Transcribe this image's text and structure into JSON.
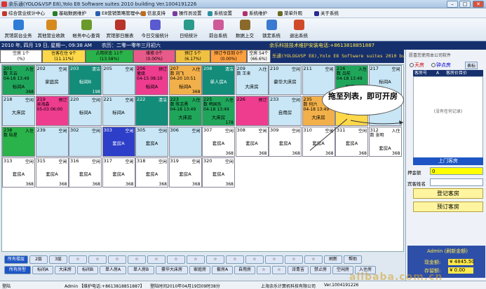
{
  "window": {
    "title": "余乐通(YOLO&VSP E8),Yolo E8 Software suites 2010 building Ver.1004191226"
  },
  "menu": [
    {
      "label": "综合营业统计中心",
      "color": "#c2392b"
    },
    {
      "label": "基础数据维护",
      "color": "#2b7d2b"
    },
    {
      "label": "E8营销策略管理中心",
      "color": "#2a5fb0"
    },
    {
      "label": "信息支持",
      "color": "#c06b1a"
    },
    {
      "label": "操作员设置",
      "color": "#7a3aa0"
    },
    {
      "label": "系统设置",
      "color": "#2a8fa0"
    },
    {
      "label": "系统维护",
      "color": "#b03070"
    },
    {
      "label": "菜单外观",
      "color": "#6a6a20"
    },
    {
      "label": "关于系统",
      "color": "#2a2a90"
    }
  ],
  "toolbar": [
    {
      "label": "宾馆前台业务",
      "color": "#2e7cd6"
    },
    {
      "label": "其他营业收款",
      "color": "#d68a1e"
    },
    {
      "label": "帐务中心查询",
      "color": "#6a9a2a"
    },
    {
      "label": "宾馆部日报表",
      "color": "#b8332a"
    },
    {
      "label": "今日交接统计",
      "color": "#5a5ad0"
    },
    {
      "label": "日结统计",
      "color": "#2a9a8a"
    },
    {
      "label": "前台系统",
      "color": "#cf5a9a"
    },
    {
      "label": "数据上交",
      "color": "#8a6a2a"
    },
    {
      "label": "锁定系统",
      "color": "#3a7ad0"
    },
    {
      "label": "退出系统",
      "color": "#d04a2a"
    }
  ],
  "statusline": {
    "date": "2010 年, 四月 19 日, 星期一, 09:38 AM",
    "lunar": "农历：二零一零年三月初六",
    "marquee": "余乐科技技术维护安装电话:+8613818851887"
  },
  "legend": [
    {
      "label": "空房 1个\n(%)",
      "bg": "#ffffff"
    },
    {
      "label": "住客在住 9个\n(11.11%)",
      "bg": "#ffd84a"
    },
    {
      "label": "占用状态 11个\n(13.58%)",
      "bg": "#2ab34a"
    },
    {
      "label": "维修 0个\n(0.00%)",
      "bg": "#e85a8a"
    },
    {
      "label": "预订 5个\n(6.17%)",
      "bg": "#f0c040"
    },
    {
      "label": "预订今日到 0个\n(0.00%)",
      "bg": "#ffa040"
    },
    {
      "label": "空房 54个\n(66.6%)",
      "bg": "#f4f4f4"
    }
  ],
  "ad_text": "乐通(YOLO&VSP E8),Yolo E8 Software suites 2010 building Ver.1004191226",
  "rooms": [
    {
      "no": "201",
      "status": "入住",
      "type": "标间A",
      "guest": "数 王云\n04-18 13:49",
      "price": "368",
      "bg": "#20a65a"
    },
    {
      "no": "202",
      "status": "空闲",
      "type": "家庭房",
      "guest": "",
      "price": "",
      "bg": "#c8e6f5"
    },
    {
      "no": "203",
      "status": "清洁",
      "type": "标间B",
      "guest": "",
      "price": "198",
      "bg": "#138c7a"
    },
    {
      "no": "205",
      "status": "空闲",
      "type": "",
      "guest": "",
      "price": "",
      "bg": "#c8e6f5"
    },
    {
      "no": "206",
      "status": "预订",
      "type": "标间A",
      "guest": "量级\n04-15 08:10",
      "price": "",
      "bg": "#ee3c8f"
    },
    {
      "no": "207",
      "status": "入住",
      "type": "标间A",
      "guest": "数 刘飞\n04-20 10:51",
      "price": "368",
      "bg": "#f2b04a"
    },
    {
      "no": "208",
      "status": "清洁",
      "type": "单人房A",
      "guest": "",
      "price": "",
      "bg": "#138c7a"
    },
    {
      "no": "209",
      "status": "入住",
      "type": "大床房",
      "guest": "数 王来",
      "price": "",
      "bg": "#c8e6f5"
    },
    {
      "no": "210",
      "status": "空闲",
      "type": "豪华大床房",
      "guest": "",
      "price": "",
      "bg": "#c8e6f5"
    },
    {
      "no": "211",
      "status": "空闲",
      "type": "",
      "guest": "",
      "price": "",
      "bg": "#c8e6f5"
    },
    {
      "no": "216",
      "status": "入住",
      "type": "标间A",
      "guest": "数 吕前\n04-18 13:49",
      "price": "",
      "bg": "#20a65a"
    },
    {
      "no": "217",
      "status": "空闲",
      "type": "标间A",
      "guest": "",
      "price": "",
      "bg": "#c8e6f5"
    },
    {
      "no": "218",
      "status": "空闲",
      "type": "大床房",
      "guest": "",
      "price": "",
      "bg": "#c8e6f5"
    },
    {
      "no": "219",
      "status": "预订",
      "type": "",
      "guest": "吴海森\n05-03 06:00",
      "price": "",
      "bg": "#ee3c8f"
    },
    {
      "no": "220",
      "status": "空闲",
      "type": "标间A",
      "guest": "",
      "price": "",
      "bg": "#c8e6f5"
    },
    {
      "no": "221",
      "status": "空闲",
      "type": "标间A",
      "guest": "",
      "price": "",
      "bg": "#c8e6f5"
    },
    {
      "no": "222",
      "status": "清洁",
      "type": "",
      "guest": "",
      "price": "",
      "bg": "#138c7a"
    },
    {
      "no": "223",
      "status": "入住",
      "type": "大床房",
      "guest": "数 陈志勇\n04-18 13:49",
      "price": "",
      "bg": "#20a65a"
    },
    {
      "no": "225",
      "status": "入住",
      "type": "大床房",
      "guest": "数 韩国东\n04-18 13:49",
      "price": "178",
      "bg": "#20a65a"
    },
    {
      "no": "226",
      "status": "预订",
      "type": "",
      "guest": "",
      "price": "",
      "bg": "#ee3c8f"
    },
    {
      "no": "233",
      "status": "空闲",
      "type": "自用房",
      "guest": "",
      "price": "",
      "bg": "#c8e6f5"
    },
    {
      "no": "235",
      "status": "入住",
      "type": "大床房",
      "guest": "数 何六\n04-18 13:49",
      "price": "",
      "bg": "#f2b04a"
    },
    {
      "no": "236",
      "status": "入住",
      "type": "标间A",
      "guest": "",
      "price": "",
      "bg": "#ffd84a"
    },
    {
      "no": "237",
      "status": "空闲",
      "type": "",
      "guest": "",
      "price": "",
      "bg": "#c8e6f5"
    },
    {
      "no": "238",
      "status": "入住",
      "type": "",
      "guest": "数 陆星",
      "price": "",
      "bg": "#2ab34a"
    },
    {
      "no": "239",
      "status": "空闲",
      "type": "",
      "guest": "",
      "price": "",
      "bg": "#c8e6f5"
    },
    {
      "no": "302",
      "status": "空闲",
      "type": "",
      "guest": "",
      "price": "",
      "bg": "#c8e6f5"
    },
    {
      "no": "303",
      "status": "空闲",
      "type": "套房A",
      "guest": "",
      "price": "",
      "bg": "#2d3ec8"
    },
    {
      "no": "305",
      "status": "空闲",
      "type": "套房A",
      "guest": "",
      "price": "",
      "bg": "#c8e6f5"
    },
    {
      "no": "306",
      "status": "空闲",
      "type": "",
      "guest": "",
      "price": "",
      "bg": "#c8e6f5"
    },
    {
      "no": "307",
      "status": "空闲",
      "type": "套房A",
      "guest": "",
      "price": "368",
      "bg": "#ffffff"
    },
    {
      "no": "308",
      "status": "空闲",
      "type": "套房A",
      "guest": "",
      "price": "368",
      "bg": "#ffffff"
    },
    {
      "no": "309",
      "status": "空闲",
      "type": "套房A",
      "guest": "",
      "price": "368",
      "bg": "#ffffff"
    },
    {
      "no": "310",
      "status": "空闲",
      "type": "套房A",
      "guest": "",
      "price": "368",
      "bg": "#ffffff"
    },
    {
      "no": "311",
      "status": "空闲",
      "type": "套房A",
      "guest": "",
      "price": "368",
      "bg": "#ffffff"
    },
    {
      "no": "312",
      "status": "入住",
      "type": "套房A",
      "guest": "数 张明",
      "price": "368",
      "bg": "#ffffff"
    },
    {
      "no": "313",
      "status": "空闲",
      "type": "套房A",
      "guest": "",
      "price": "368",
      "bg": "#ffffff"
    },
    {
      "no": "315",
      "status": "空闲",
      "type": "套房A",
      "guest": "",
      "price": "368",
      "bg": "#ffffff"
    },
    {
      "no": "316",
      "status": "空闲",
      "type": "套房A",
      "guest": "",
      "price": "368",
      "bg": "#ffffff"
    },
    {
      "no": "317",
      "status": "空闲",
      "type": "套房A",
      "guest": "",
      "price": "368",
      "bg": "#ffffff"
    },
    {
      "no": "318",
      "status": "空闲",
      "type": "套房A",
      "guest": "",
      "price": "368",
      "bg": "#ffffff"
    },
    {
      "no": "319",
      "status": "空闲",
      "type": "套房A",
      "guest": "",
      "price": "368",
      "bg": "#ffffff"
    },
    {
      "no": "320",
      "status": "空闲",
      "type": "套房A",
      "guest": "",
      "price": "368",
      "bg": "#ffffff"
    }
  ],
  "callout": "拖至列表，即可开房",
  "floor_buttons": [
    "所有楼层",
    "2层",
    "3层",
    "☆",
    "☆",
    "☆",
    "☆",
    "☆",
    "☆",
    "☆",
    "☆",
    "☆",
    "☆",
    "☆",
    "☆",
    "☆",
    "刷新",
    "帮助"
  ],
  "type_buttons": [
    "所有房型",
    "标间A",
    "大床房",
    "标间B",
    "单人房A",
    "单人房B",
    "豪华大床房",
    "家庭房",
    "套房A",
    "自用房",
    "☆",
    "☆",
    "诗青吉",
    "禁止房",
    "空闲房",
    "入住房"
  ],
  "right_panel": {
    "header": "愿喜您使用本公司软件",
    "radio1": "天房",
    "radio2": "钟点房",
    "radio_btn": "表标",
    "col1": "客房号",
    "col2": "A",
    "col3": "客房价目价",
    "empty": "(没有任何记录)",
    "ups": "上门客房",
    "deposit_label": "押金额",
    "deposit_value": "0",
    "guest_label": "宾客姓名",
    "btn_register": "登记客房",
    "btn_reserve": "预订客房",
    "admin": "Admin (刷新金额)",
    "cash_label": "现金额:",
    "cash_value": "¥ 4845.50",
    "sum_label": "存留额:",
    "sum_value": "¥ 0.00"
  },
  "statusbar": {
    "left": "登陆",
    "user": "Admin 【维护电话:+8613818851887】",
    "login": "登陆时间2010年04月19日09时38分",
    "company": "上海余乐计算机科技有限公司",
    "ver": "Ver.1004191226"
  },
  "watermark": "alibaba.com.cn"
}
